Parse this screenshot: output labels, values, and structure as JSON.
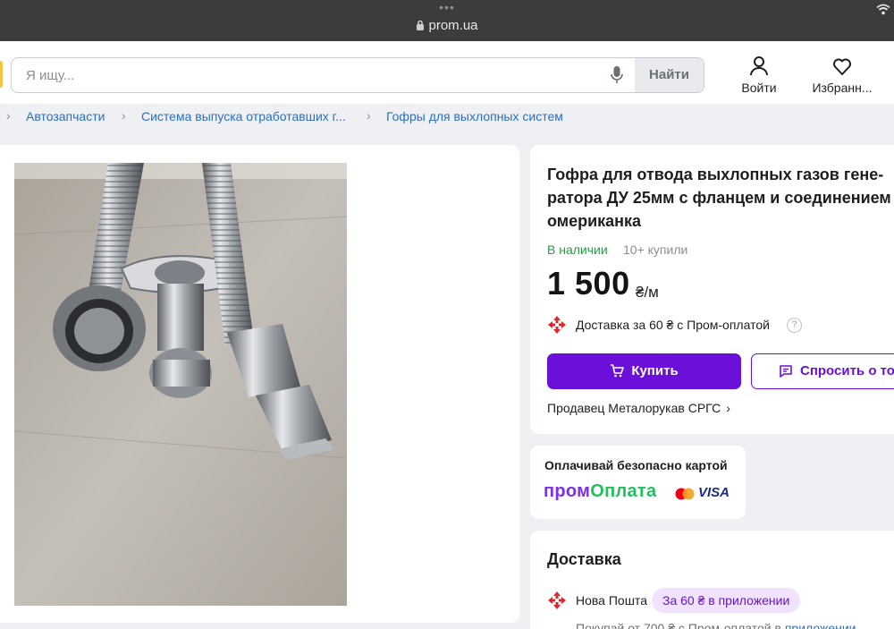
{
  "browser": {
    "dots": "•••",
    "url": "prom.ua"
  },
  "header": {
    "search_placeholder": "Я ищу...",
    "search_button": "Найти",
    "login_label": "Войти",
    "favorites_label": "Избранн..."
  },
  "breadcrumbs": [
    "Автозапчасти",
    "Система выпуска отработавших г...",
    "Гофры для выхлопных систем"
  ],
  "product": {
    "title": "Гофра для отвода выхлопных газов гене-ратора ДУ 25мм с фланцем и соединением омериканка",
    "stock": "В наличии",
    "sold": "10+ купили",
    "price": "1 500",
    "unit": "₴/м",
    "delivery_text": "Доставка за 60 ₴ с Пром-оплатой",
    "help": "?",
    "buy_label": "Купить",
    "ask_label": "Спросить о товаре",
    "seller": "Продавец Металорукав СРГС",
    "seller_arrow": "›"
  },
  "payment": {
    "title": "Оплачивай безопасно картой",
    "brand_part1": "пром",
    "brand_part2": "Оплата",
    "card_visa": "VISA"
  },
  "shipping": {
    "title": "Доставка",
    "carrier": "Нова Пошта",
    "badge": "За 60 ₴ в приложении",
    "note_prefix": "Покупай от 700 ₴ с Пром-оплатой в ",
    "note_link": "приложении"
  },
  "colors": {
    "accent_purple": "#6a10d8",
    "link_blue": "#2b6fc2",
    "in_stock_green": "#1f9e3f",
    "nova_poshta_red": "#e0262b"
  },
  "icons": [
    "lock-icon",
    "wifi-icon",
    "microphone-icon",
    "user-icon",
    "heart-icon",
    "chevron-right-icon",
    "nova-poshta-icon",
    "question-icon",
    "cart-icon",
    "message-icon",
    "mastercard-icon"
  ]
}
